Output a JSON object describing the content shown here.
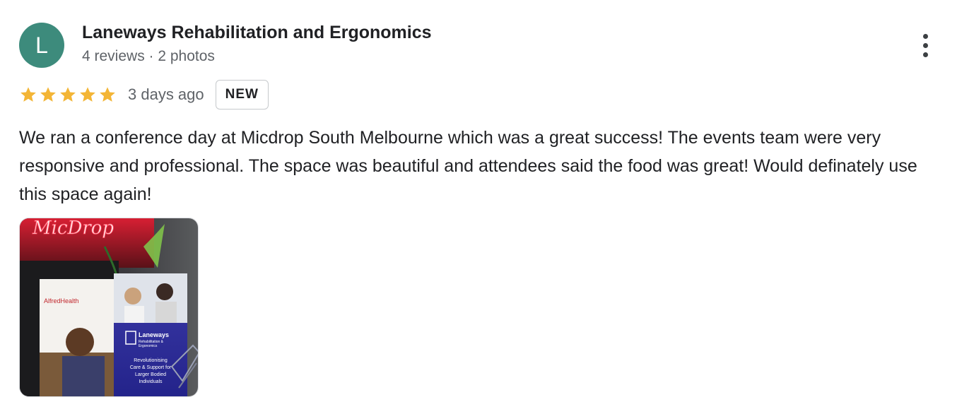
{
  "reviewer": {
    "initial": "L",
    "name": "Laneways Rehabilitation and Ergonomics",
    "meta": "4 reviews · 2 photos",
    "avatar_color": "#3d8b7c"
  },
  "rating": {
    "stars": 5,
    "max_stars": 5,
    "star_color": "#f3b536",
    "date": "3 days ago",
    "badge": "NEW"
  },
  "review": {
    "text": "We ran a conference day at Micdrop South Melbourne which was a great success! The events team were very responsive and professional. The space was beautiful and attendees said the food was great! Would definately use this space again!"
  },
  "photo": {
    "neon_sign": "MicDrop",
    "banner_left": "AlfredHealth",
    "banner_right_title": "Laneways",
    "banner_right_subtitle_1": "Rehabilitation &",
    "banner_right_subtitle_2": "Ergonomics",
    "banner_right_tagline_1": "Revolutionising",
    "banner_right_tagline_2": "Care & Support for",
    "banner_right_tagline_3": "Larger Bodied",
    "banner_right_tagline_4": "Individuals"
  },
  "icons": {
    "more": "more-vert-icon",
    "star": "star-icon"
  }
}
